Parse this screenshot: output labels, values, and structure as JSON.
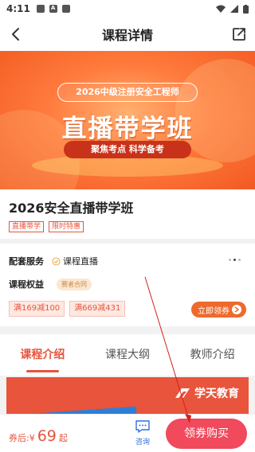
{
  "status_bar": {
    "time": "4:11"
  },
  "navbar": {
    "title": "课程详情",
    "back_icon": "chevron-left-icon",
    "share_icon": "share-icon"
  },
  "banner": {
    "subtitle": "2026中级注册安全工程师",
    "headline": "直播带学班",
    "tagline": "聚焦考点 科学备考"
  },
  "course": {
    "title": "2026安全直播带学班",
    "tags": [
      "直播带学",
      "限时特惠"
    ]
  },
  "services": {
    "label": "配套服务",
    "item": "课程直播",
    "rights_label": "课程权益",
    "rights_tag": "赛者合同",
    "coupons": [
      "满169减100",
      "满669减431"
    ],
    "claim_label": "立即领券"
  },
  "tabs": [
    {
      "label": "课程介绍",
      "active": true
    },
    {
      "label": "课程大纲",
      "active": false
    },
    {
      "label": "教师介绍",
      "active": false
    }
  ],
  "content": {
    "brand": "学天教育"
  },
  "bottom": {
    "price_prefix": "券后:",
    "currency": "¥",
    "price": "69",
    "price_suffix": "起",
    "consult_label": "咨询",
    "buy_label": "领券购买"
  },
  "colors": {
    "accent": "#e8543c",
    "buy_button": "#f04a5c",
    "banner": "#ff7a3c"
  }
}
